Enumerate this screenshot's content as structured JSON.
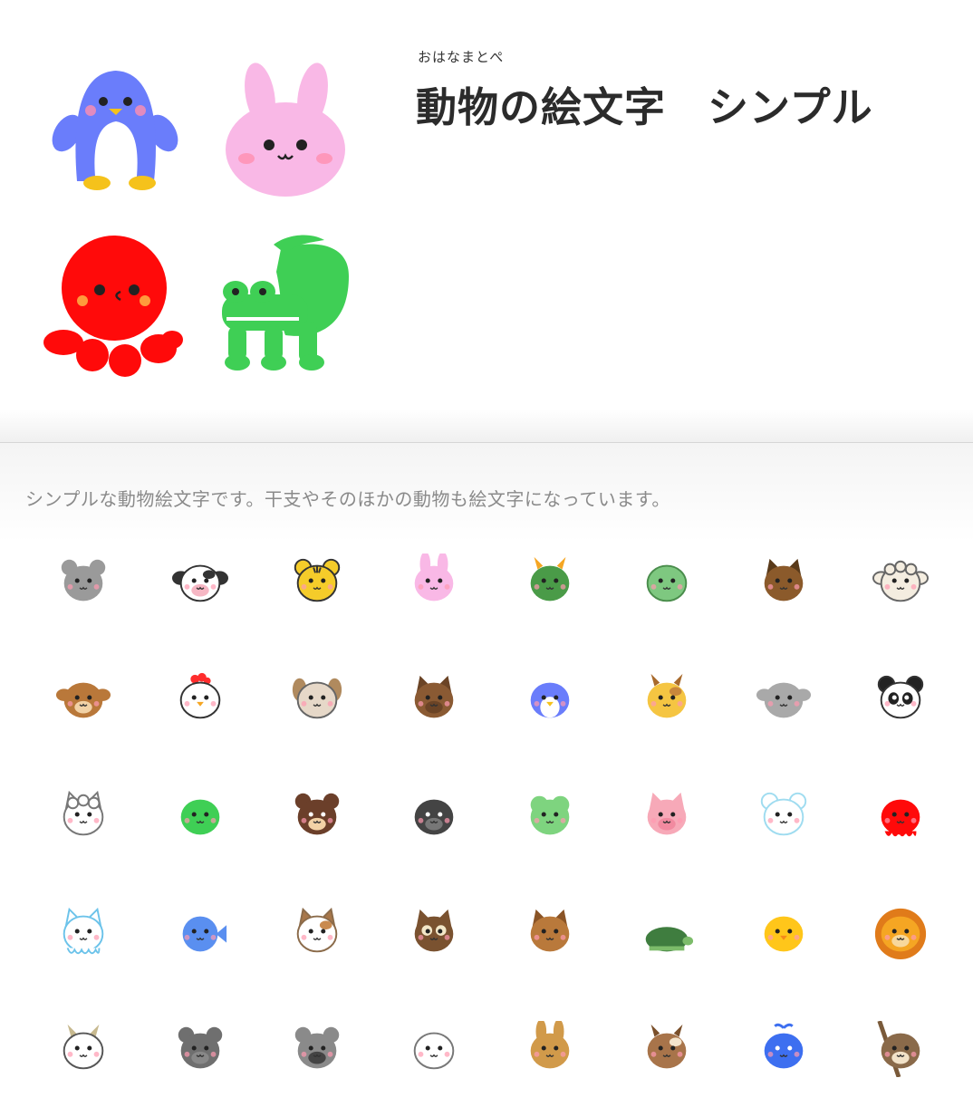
{
  "header": {
    "author": "おはなまとぺ",
    "title": "動物の絵文字　シンプル",
    "hero_icons": [
      "penguin-icon",
      "rabbit-icon",
      "octopus-icon",
      "crocodile-icon"
    ]
  },
  "description": "シンプルな動物絵文字です。干支やそのほかの動物も絵文字になっています。",
  "emoji_grid": [
    "mouse-icon",
    "cow-icon",
    "tiger-icon",
    "rabbit-icon",
    "dragon-icon",
    "snake-icon",
    "horse-icon",
    "sheep-icon",
    "monkey-icon",
    "chicken-icon",
    "dog-icon",
    "boar-icon",
    "penguin-icon",
    "giraffe-icon",
    "elephant-icon",
    "panda-icon",
    "alpaca-icon",
    "crocodile-icon",
    "bear-icon",
    "gorilla-icon",
    "frog-icon",
    "pig-icon",
    "polar-bear-icon",
    "octopus-icon",
    "squid-icon",
    "fish-icon",
    "cat-icon",
    "owl-icon",
    "squirrel-icon",
    "turtle-icon",
    "chick-icon",
    "lion-icon",
    "goat-icon",
    "hippo-icon",
    "koala-icon",
    "seal-icon",
    "kangaroo-icon",
    "deer-icon",
    "whale-icon",
    "sloth-icon"
  ],
  "colors": {
    "penguin": "#6a7dfb",
    "rabbit": "#f9b8e6",
    "octopus": "#ff0a0a",
    "crocodile": "#3fcf55",
    "feet": "#f5c21b",
    "cheek": "#ff8fb0",
    "text": "#2b2b2b",
    "description": "#8a8a8a"
  }
}
